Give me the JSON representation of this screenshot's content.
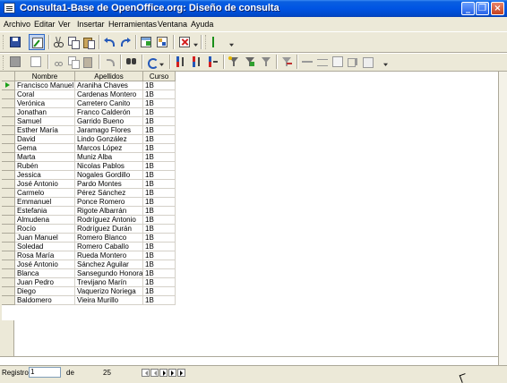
{
  "window": {
    "title": "Consulta1-Base de OpenOffice.org: Diseño de consulta",
    "minimize_glyph": "_",
    "restore_glyph": "❐",
    "close_glyph": "×"
  },
  "menu": [
    {
      "label": "Archivo"
    },
    {
      "label": "Editar"
    },
    {
      "label": "Ver"
    },
    {
      "label": "Insertar"
    },
    {
      "label": "Herramientas"
    },
    {
      "label": "Ventana"
    },
    {
      "label": "Ayuda"
    }
  ],
  "toolbar1": {
    "icons": [
      "save-icon",
      "edit-design-icon",
      "cut-icon",
      "copy-icon",
      "paste-icon",
      "undo-icon",
      "redo-icon",
      "add-table-icon",
      "add-query-icon",
      "delete-icon",
      "sql-icon"
    ]
  },
  "toolbar2": {
    "icons": [
      "save-record-icon",
      "edit-data-icon",
      "cut-icon",
      "copy-icon",
      "paste-icon",
      "undo-icon",
      "find-record-icon",
      "refresh-icon",
      "sort-ascending-icon",
      "sort-descending-icon",
      "autofilter-icon",
      "standard-filter-icon",
      "apply-filter-icon",
      "remove-filter-icon",
      "data-to-text-icon",
      "data-to-fields-icon",
      "mail-merge-icon",
      "data-source-icon",
      "explorer-icon"
    ]
  },
  "grid": {
    "columns": [
      "Nombre",
      "Apellidos",
      "Curso"
    ],
    "rows": [
      [
        "Francisco Manuel",
        "Araniha Chaves",
        "1B"
      ],
      [
        "Coral",
        "Cardenas Montero",
        "1B"
      ],
      [
        "Verónica",
        "Carretero Canito",
        "1B"
      ],
      [
        "Jonathan",
        "Franco Calderón",
        "1B"
      ],
      [
        "Samuel",
        "Garrido Bueno",
        "1B"
      ],
      [
        "Esther María",
        "Jaramago Flores",
        "1B"
      ],
      [
        "David",
        "Lindo González",
        "1B"
      ],
      [
        "Gema",
        "Marcos López",
        "1B"
      ],
      [
        "Marta",
        "Muniz Alba",
        "1B"
      ],
      [
        "Rubén",
        "Nicolas Pablos",
        "1B"
      ],
      [
        "Jessica",
        "Nogales Gordillo",
        "1B"
      ],
      [
        "José Antonio",
        "Pardo Montes",
        "1B"
      ],
      [
        "Carmelo",
        "Pérez Sánchez",
        "1B"
      ],
      [
        "Emmanuel",
        "Ponce Romero",
        "1B"
      ],
      [
        "Estefania",
        "Rigote Albarrán",
        "1B"
      ],
      [
        "Almudena",
        "Rodríguez Antonio",
        "1B"
      ],
      [
        "Rocío",
        "Rodríguez Durán",
        "1B"
      ],
      [
        "Juan Manuel",
        "Romero Blanco",
        "1B"
      ],
      [
        "Soledad",
        "Romero Caballo",
        "1B"
      ],
      [
        "Rosa María",
        "Rueda Montero",
        "1B"
      ],
      [
        "José Antonio",
        "Sánchez Aguilar",
        "1B"
      ],
      [
        "Blanca",
        "Sansegundo Honorato",
        "1B"
      ],
      [
        "Juan Pedro",
        "Trevijano Marín",
        "1B"
      ],
      [
        "Diego",
        "Vaquerizo Noriega",
        "1B"
      ],
      [
        "Baldomero",
        "Vieira Murillo",
        "1B"
      ]
    ]
  },
  "status": {
    "record_label": "Registro",
    "record_value": "1",
    "of_label": "de",
    "total": "25"
  }
}
